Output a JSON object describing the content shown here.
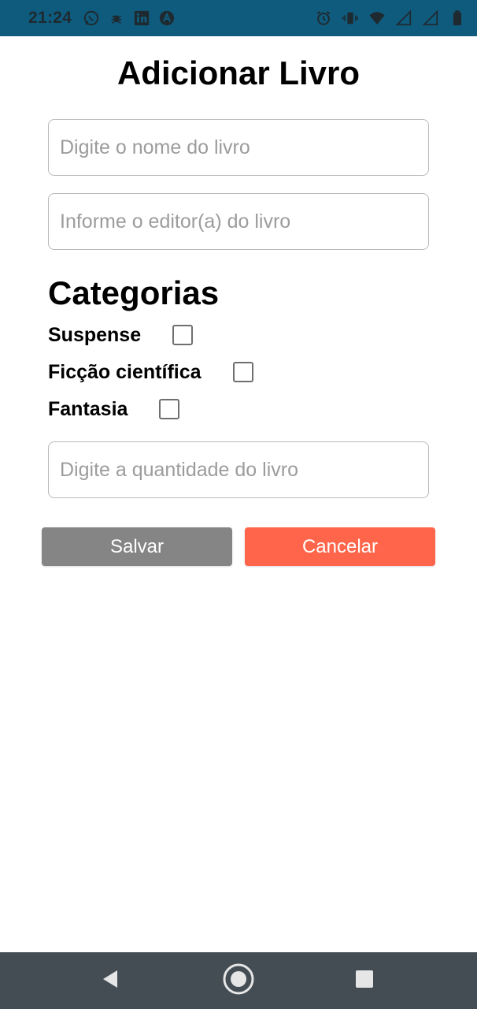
{
  "status_bar": {
    "time": "21:24",
    "left_icons": [
      "whatsapp-icon",
      "bug-icon",
      "linkedin-icon",
      "app-icon"
    ],
    "right_icons": [
      "alarm-icon",
      "vibrate-icon",
      "wifi-icon",
      "signal-icon",
      "signal-icon",
      "battery-icon"
    ]
  },
  "form": {
    "title": "Adicionar Livro",
    "name_placeholder": "Digite o nome do livro",
    "editor_placeholder": "Informe o editor(a) do livro",
    "categories_title": "Categorias",
    "categories": [
      {
        "label": "Suspense",
        "checked": false
      },
      {
        "label": "Ficção científica",
        "checked": false
      },
      {
        "label": "Fantasia",
        "checked": false
      }
    ],
    "quantity_placeholder": "Digite a quantidade do livro"
  },
  "buttons": {
    "save_label": "Salvar",
    "cancel_label": "Cancelar"
  },
  "colors": {
    "status_bar": "#0f5b7e",
    "save_button": "#858585",
    "cancel_button": "#fe654b",
    "nav_bar": "#444d54"
  },
  "nav_bar": {
    "icons": [
      "back-icon",
      "home-icon",
      "recents-icon"
    ]
  }
}
